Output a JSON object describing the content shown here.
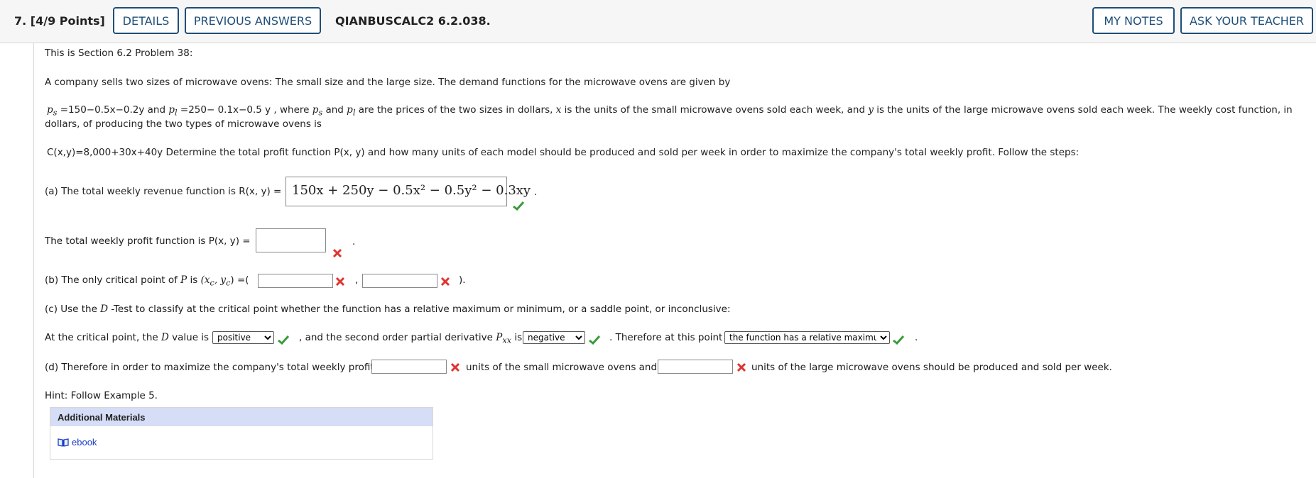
{
  "header": {
    "question_number": "7.",
    "points": "[4/9 Points]",
    "details_label": "DETAILS",
    "previous_answers_label": "PREVIOUS ANSWERS",
    "problem_code": "QIANBUSCALC2 6.2.038.",
    "my_notes_label": "MY NOTES",
    "ask_teacher_label": "ASK YOUR TEACHER"
  },
  "intro": "This is Section 6.2 Problem 38:",
  "prompt": "A company sells two sizes of microwave ovens: The small size and the large size. The demand functions for the microwave ovens are given by",
  "demand": {
    "ps_label": "p",
    "ps_sub": "s",
    "ps_expr": " =150−0.5x−0.2y  and  ",
    "pl_label": "p",
    "pl_sub": "l",
    "pl_expr": " =250− 0.1x−0.5 y , where  ",
    "where_ps": "p",
    "where_ps_sub": "s",
    "where_and": "  and  ",
    "where_pl": "p",
    "where_pl_sub": "l",
    "tail1": "  are the prices of the two sizes in dollars,  ",
    "x_var": "x",
    "tail2": "  is the units of the small microwave ovens sold each week, and  ",
    "y_var": "y",
    "tail3": "  is the units of the large microwave ovens sold each week. The weekly cost function, in",
    "line2": "dollars, of producing the two types of microwave ovens is"
  },
  "cost": {
    "expr": "C(x,y)=8,000+30x+40y",
    "mid": "  Determine the total profit function  ",
    "P_func": "P(x, y)",
    "rest": "  and how many units of each model should be produced and sold per week in order to maximize the company's total weekly profit. Follow the steps:"
  },
  "part_a": {
    "label": "(a) The total weekly revenue function is  ",
    "R_func": "R(x, y)",
    "eq": "  =",
    "answer": "150x + 250y − 0.5x² − 0.5y² − 0.3xy",
    "status": "correct",
    "after": "."
  },
  "profit": {
    "label": "The total weekly profit function is  ",
    "P_func": "P(x, y)",
    "eq": "  =",
    "answer": "",
    "status": "incorrect",
    "after": "."
  },
  "part_b": {
    "label": "(b) The only critical point of  ",
    "P": "P",
    "is": "  is  ",
    "point": "(x",
    "sub_c": "c",
    "comma": ", y",
    "sub_c2": "c",
    "close": ")",
    "eq": " =(",
    "x_answer": "",
    "sep": ",",
    "y_answer": "",
    "end": ").",
    "status_x": "incorrect",
    "status_y": "incorrect"
  },
  "part_c": {
    "label": "(c) Use the  ",
    "D": "D",
    "rest": " -Test to classify at the critical point whether the function has a relative maximum or minimum, or a saddle point, or inconclusive:",
    "at_label": "At the critical point, the  ",
    "D2": "D",
    "value_is": "  value is",
    "d_value": "positive",
    "second_order": " , and the second order partial derivative  ",
    "Pxx": "P",
    "Pxx_sub": "xx",
    "is": "  is",
    "pxx_value": "negative",
    "therefore": " . Therefore at this point",
    "conclusion": "the function has a relative maximum",
    "end": "."
  },
  "part_d": {
    "label": "(d) Therefore in order to maximize the company's total weekly profit,",
    "small_answer": "",
    "mid": "  units of the small microwave ovens and",
    "large_answer": "",
    "end": "  units of the large microwave ovens should be produced and sold per week."
  },
  "hint": "Hint: Follow Example 5.",
  "materials": {
    "title": "Additional Materials",
    "ebook_label": "ebook"
  },
  "colors": {
    "accent": "#1f4e79",
    "correct": "#3a9a3a",
    "incorrect": "#e0342f",
    "materials_header": "#d6ddf6",
    "link": "#1a3fc4"
  }
}
